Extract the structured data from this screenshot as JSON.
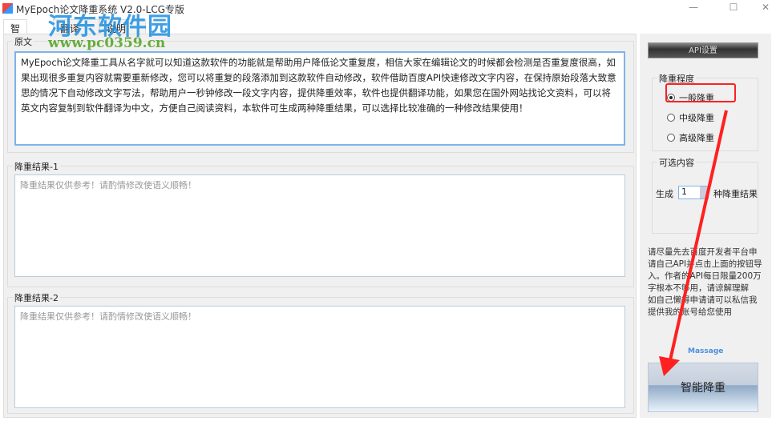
{
  "window": {
    "title": "MyEpoch论文降重系统 V2.0-LCG专版",
    "minimize": "—",
    "maximize": "☐",
    "close": "✕"
  },
  "tabs": [
    {
      "label": "智能降重"
    },
    {
      "label": "翻译"
    },
    {
      "label": "说明"
    }
  ],
  "original": {
    "label": "原文",
    "text": "MyEpoch论文降重工具从名字就可以知道这款软件的功能就是帮助用户降低论文重复度，相信大家在编辑论文的时候都会检测是否重复度很高，如果出现很多重复内容就需要重新修改，您可以将重复的段落添加到这款软件自动修改，软件借助百度API快速修改文字内容，在保持原始段落大致意思的情况下自动修改文字写法，帮助用户一秒钟修改一段文字内容，提供降重效率，软件也提供翻译功能，如果您在国外网站找论文资料，可以将英文内容复制到软件翻译为中文，方便自己阅读资料，本软件可生成两种降重结果，可以选择比较准确的一种修改结果使用！"
  },
  "result1": {
    "label": "降重结果-1",
    "placeholder": "降重结果仅供参考！请酌情修改使语义顺畅！"
  },
  "result2": {
    "label": "降重结果-2",
    "placeholder": "降重结果仅供参考！请酌情修改使语义顺畅！"
  },
  "side": {
    "api_button": "API设置",
    "level": {
      "label": "降重程度",
      "options": [
        {
          "label": "一般降重",
          "checked": true
        },
        {
          "label": "中级降重",
          "checked": false
        },
        {
          "label": "高级降重",
          "checked": false
        }
      ]
    },
    "optional": {
      "label": "可选内容",
      "prefix": "生成",
      "value": "1",
      "suffix": "种降重结果"
    },
    "message": "请尽量先去百度开发者平台申请自己API并点击上面的按钮导入。作者的API每日限量200万字根本不够用，请谅解理解\n如自己懒得申请请可以私信我提供我的账号给您使用",
    "massage_link": "Massage",
    "run_button": "智能降重"
  },
  "watermark": {
    "name": "河东软件园",
    "url": "www.pc0359.cn"
  },
  "annotation": {
    "highlight_color": "#ff2020"
  }
}
